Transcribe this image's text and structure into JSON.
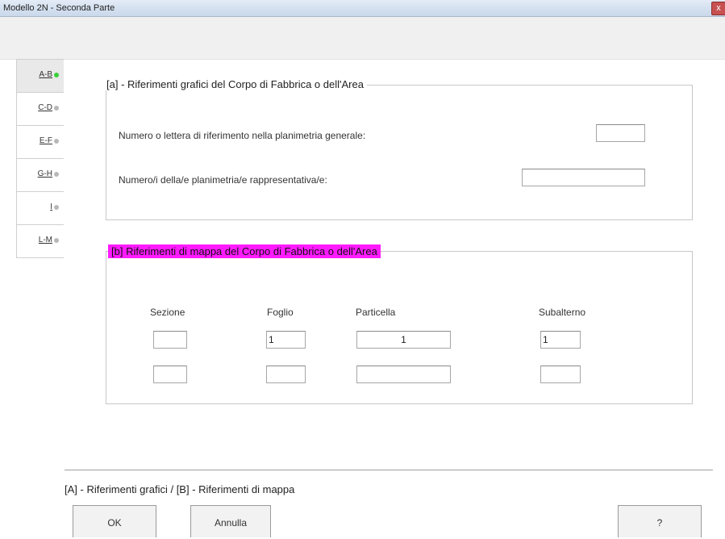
{
  "window": {
    "title": "Modello 2N - Seconda Parte",
    "close_glyph": "x"
  },
  "tabs": [
    {
      "label": "A-B",
      "active": true
    },
    {
      "label": "C-D",
      "active": false
    },
    {
      "label": "E-F",
      "active": false
    },
    {
      "label": "G-H",
      "active": false
    },
    {
      "label": "I",
      "active": false
    },
    {
      "label": "L-M",
      "active": false
    }
  ],
  "section_a": {
    "legend": "[a] - Riferimenti grafici del Corpo di Fabbrica o dell'Area",
    "row1_label": "Numero o lettera di riferimento nella planimetria generale:",
    "row1_value": "",
    "row2_label": "Numero/i della/e planimetria/e rappresentativa/e:",
    "row2_value": ""
  },
  "section_b": {
    "legend": "[b] Riferimenti di mappa del Corpo di Fabbrica o dell'Area",
    "legend_color": "#ff1aff",
    "headers": {
      "sezione": "Sezione",
      "foglio": "Foglio",
      "particella": "Particella",
      "subalterno": "Subalterno"
    },
    "row1": {
      "sezione": "",
      "foglio": "1",
      "particella": "1",
      "subalterno": "1"
    },
    "row2": {
      "sezione": "",
      "foglio": "",
      "particella": "",
      "subalterno": ""
    }
  },
  "status_text": "[A] - Riferimenti grafici / [B] - Riferimenti di mappa",
  "buttons": {
    "ok": "OK",
    "cancel": "Annulla",
    "help": "?"
  }
}
